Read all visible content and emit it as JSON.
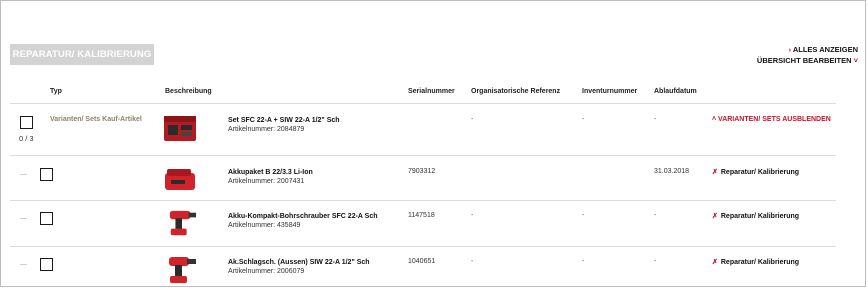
{
  "toolbar": {
    "repair_button": "REPARATUR/ KALIBRIERUNG",
    "show_all": "ALLES ANZEIGEN",
    "edit_overview": "ÜBERSICHT BEARBEITEN",
    "show_all_icon": "chevron-right-icon",
    "edit_overview_icon": "chevron-down-icon"
  },
  "columns": {
    "type": "Typ",
    "description": "Beschreibung",
    "serial": "Serialnummer",
    "org_ref": "Organisatorische Referenz",
    "inventory": "Inventurnummer",
    "expiry": "Ablaufdatum"
  },
  "set_row": {
    "selected_count": "0 / 3",
    "type_label": "Varianten/ Sets Kauf-Artikel",
    "title": "Set SFC 22-A + SIW 22-A 1/2\" Sch",
    "article": "Artikelnummer:  2084879",
    "serial": "",
    "org_ref": "-",
    "inventory": "-",
    "expiry": "-",
    "toggle_label": "VARIANTEN/ SETS AUSBLENDEN",
    "toggle_icon": "chevron-up-icon"
  },
  "items": [
    {
      "title": "Akkupaket B 22/3.3 Li-Ion",
      "article": "Artikelnummer:  2007431",
      "serial": "7903312",
      "org_ref": "",
      "inventory": "",
      "expiry": "31.03.2018",
      "action": "Reparatur/ Kalibrierung"
    },
    {
      "title": "Akku-Kompakt-Bohrschrauber SFC 22-A Sch",
      "article": "Artikelnummer:  435849",
      "serial": "1147518",
      "org_ref": "-",
      "inventory": "-",
      "expiry": "-",
      "action": "Reparatur/ Kalibrierung"
    },
    {
      "title": "Ak.Schlagsch. (Aussen) SIW 22-A 1/2\" Sch",
      "article": "Artikelnummer:  2006079",
      "serial": "1040651",
      "org_ref": "-",
      "inventory": "-",
      "expiry": "-",
      "action": "Reparatur/ Kalibrierung"
    }
  ],
  "colors": {
    "accent": "#c8102e",
    "tool_red": "#d2232a",
    "button_grey": "#d3d3d3"
  }
}
